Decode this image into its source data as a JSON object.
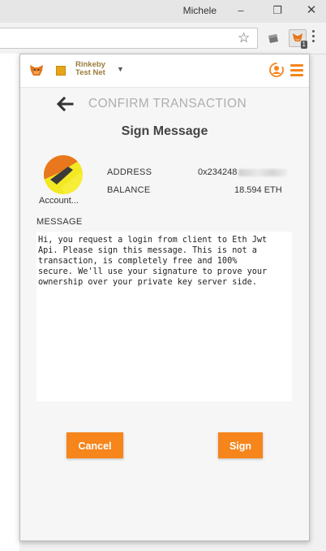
{
  "window": {
    "user_name": "Michele",
    "min_glyph": "–",
    "max_glyph": "❐",
    "close_glyph": "✕"
  },
  "browser": {
    "star_glyph": "☆",
    "extension_badge": "1"
  },
  "header": {
    "network_name": "Rinkeby Test Net",
    "caret": "▼",
    "accent_color": "#f6851b"
  },
  "page": {
    "title": "CONFIRM TRANSACTION",
    "subtitle": "Sign Message"
  },
  "account": {
    "name": "Account...",
    "address_label": "ADDRESS",
    "address_value": "0x234248",
    "balance_label": "BALANCE",
    "balance_value": "18.594 ETH"
  },
  "message": {
    "label": "MESSAGE",
    "text": "Hi, you request a login from client to Eth Jwt\nApi. Please sign this message. This is not a\ntransaction, is completely free and 100%\nsecure. We'll use your signature to prove your\nownership over your private key server side."
  },
  "actions": {
    "cancel_label": "Cancel",
    "sign_label": "Sign"
  },
  "icons": [
    "metamask-fox-icon",
    "network-icon",
    "account-switch-icon",
    "menu-icon",
    "back-arrow-icon",
    "star-icon",
    "kebab-menu-icon"
  ]
}
